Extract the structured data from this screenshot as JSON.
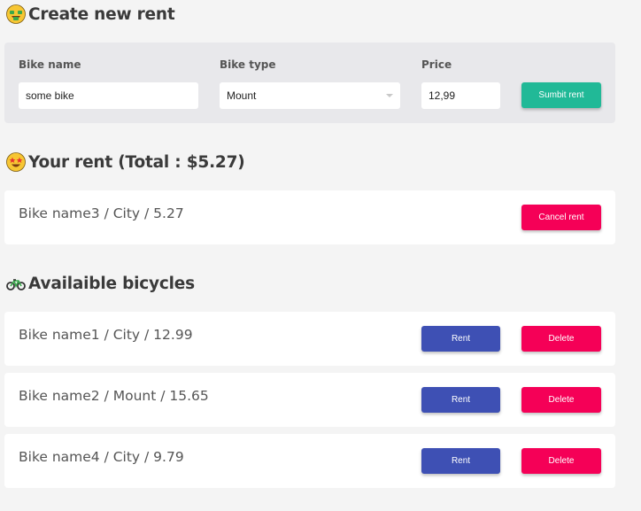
{
  "create_section": {
    "title": "Create new rent",
    "icon": "money-mouth-face-icon"
  },
  "form": {
    "bike_name_label": "Bike name",
    "bike_name_value": "some bike",
    "bike_type_label": "Bike type",
    "bike_type_value": "Mount",
    "price_label": "Price",
    "price_value": "12,99",
    "submit_label": "Sumbit rent"
  },
  "rent_section": {
    "title": "Your rent (Total : $5.27)",
    "icon": "star-struck-face-icon",
    "items": [
      {
        "text": "Bike name3 / City / 5.27",
        "cancel_label": "Cancel rent"
      }
    ]
  },
  "available_section": {
    "title": "Availaible bicycles",
    "icon": "bicycle-icon",
    "items": [
      {
        "text": "Bike name1 / City / 12.99",
        "rent_label": "Rent",
        "delete_label": "Delete"
      },
      {
        "text": "Bike name2 / Mount / 15.65",
        "rent_label": "Rent",
        "delete_label": "Delete"
      },
      {
        "text": "Bike name4 / City / 9.79",
        "rent_label": "Rent",
        "delete_label": "Delete"
      }
    ]
  },
  "colors": {
    "page_bg": "#f4f4f4",
    "panel_bg": "#e8e8eb",
    "submit_green": "#21b997",
    "rent_blue": "#3e50b4",
    "delete_red": "#f50057"
  }
}
